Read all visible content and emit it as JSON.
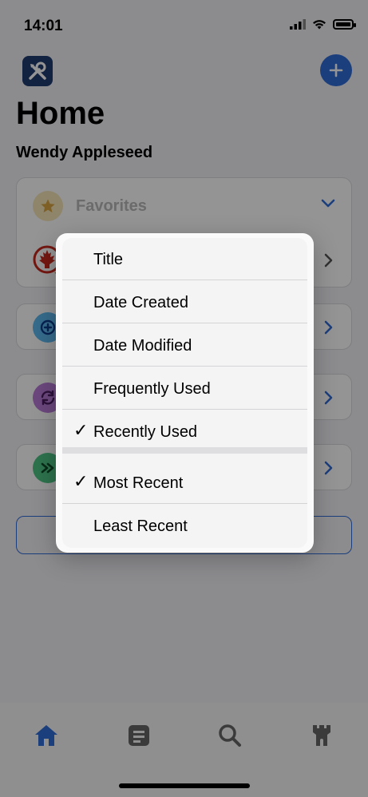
{
  "status_bar": {
    "time": "14:01"
  },
  "header": {
    "title": "Home",
    "subtitle": "Wendy Appleseed"
  },
  "favorites": {
    "label": "Favorites"
  },
  "sort_menu": {
    "sort_options": [
      {
        "label": "Title",
        "checked": false
      },
      {
        "label": "Date Created",
        "checked": false
      },
      {
        "label": "Date Modified",
        "checked": false
      },
      {
        "label": "Frequently Used",
        "checked": false
      },
      {
        "label": "Recently Used",
        "checked": true
      }
    ],
    "order_options": [
      {
        "label": "Most Recent",
        "checked": true
      },
      {
        "label": "Least Recent",
        "checked": false
      }
    ],
    "check_glyph": "✓"
  },
  "tab_bar": {
    "tabs": [
      {
        "icon": "house-icon",
        "selected": true
      },
      {
        "icon": "note-icon",
        "selected": false
      },
      {
        "icon": "search-icon",
        "selected": false
      },
      {
        "icon": "tower-icon",
        "selected": false
      }
    ]
  },
  "colors": {
    "accent": "#2f6bd8",
    "dim": "rgba(0,0,0,0.42)"
  }
}
